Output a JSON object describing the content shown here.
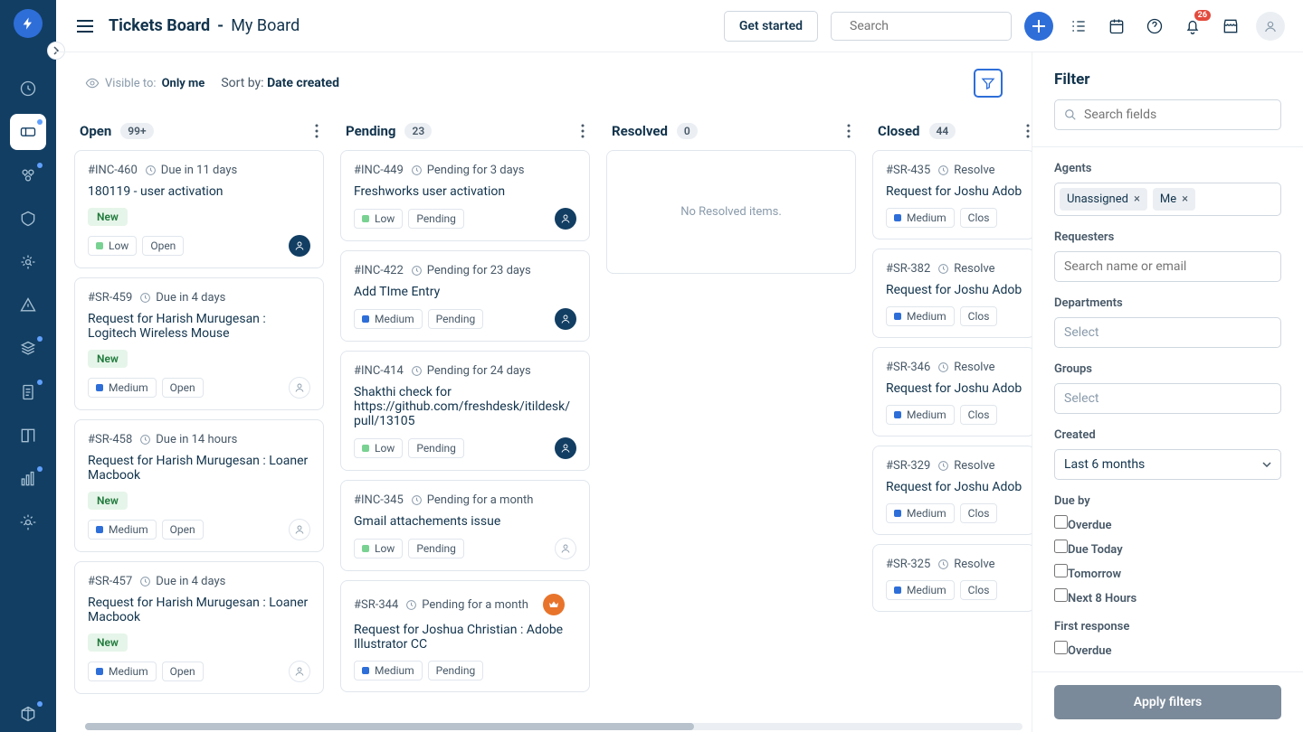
{
  "title": {
    "main": "Tickets Board",
    "sub": "My Board"
  },
  "topbar": {
    "get_started": "Get started",
    "search_placeholder": "Search",
    "notif_count": "26"
  },
  "subheader": {
    "visible_label": "Visible to:",
    "visible_value": "Only me",
    "sort_label": "Sort by:",
    "sort_value": "Date created"
  },
  "columns": [
    {
      "name": "Open",
      "count": "99+",
      "empty": null,
      "cards": [
        {
          "id": "#INC-460",
          "due": "Due in 11 days",
          "subject": "180119 - user activation",
          "new": true,
          "priority": "Low",
          "status": "Open",
          "avatar": "dark"
        },
        {
          "id": "#SR-459",
          "due": "Due in 4 days",
          "subject": "Request for Harish Murugesan : Logitech Wireless Mouse",
          "new": true,
          "priority": "Medium",
          "status": "Open",
          "avatar": "lite"
        },
        {
          "id": "#SR-458",
          "due": "Due in 14 hours",
          "subject": "Request for Harish Murugesan : Loaner Macbook",
          "new": true,
          "priority": "Medium",
          "status": "Open",
          "avatar": "lite"
        },
        {
          "id": "#SR-457",
          "due": "Due in 4 days",
          "subject": "Request for Harish Murugesan : Loaner Macbook",
          "new": true,
          "priority": "Medium",
          "status": "Open",
          "avatar": "lite"
        }
      ]
    },
    {
      "name": "Pending",
      "count": "23",
      "empty": null,
      "cards": [
        {
          "id": "#INC-449",
          "due": "Pending for 3 days",
          "subject": "Freshworks user activation",
          "new": false,
          "priority": "Low",
          "status": "Pending",
          "avatar": "dark"
        },
        {
          "id": "#INC-422",
          "due": "Pending for 23 days",
          "subject": "Add TIme Entry",
          "new": false,
          "priority": "Medium",
          "status": "Pending",
          "avatar": "dark"
        },
        {
          "id": "#INC-414",
          "due": "Pending for 24 days",
          "subject": "Shakthi check for https://github.com/freshdesk/itildesk/pull/13105",
          "new": false,
          "priority": "Low",
          "status": "Pending",
          "avatar": "dark"
        },
        {
          "id": "#INC-345",
          "due": "Pending for a month",
          "subject": "Gmail attachements issue",
          "new": false,
          "priority": "Low",
          "status": "Pending",
          "avatar": "lite"
        },
        {
          "id": "#SR-344",
          "due": "Pending for a month",
          "subject": "Request for Joshua Christian : Adobe Illustrator CC",
          "new": false,
          "priority": "Medium",
          "status": "Pending",
          "avatar": "orange",
          "avatar_inline": true
        }
      ]
    },
    {
      "name": "Resolved",
      "count": "0",
      "empty": "No Resolved items.",
      "cards": []
    },
    {
      "name": "Closed",
      "count": "44",
      "empty": null,
      "closed": true,
      "cards": [
        {
          "id": "#SR-435",
          "due": "Resolve",
          "subject": "Request for Joshu Adobe Illustrator C",
          "priority": "Medium",
          "status": "Clos"
        },
        {
          "id": "#SR-382",
          "due": "Resolve",
          "subject": "Request for Joshu Adobe Illustrator C",
          "priority": "Medium",
          "status": "Clos"
        },
        {
          "id": "#SR-346",
          "due": "Resolve",
          "subject": "Request for Joshu Adobe Illustrator C",
          "priority": "Medium",
          "status": "Clos"
        },
        {
          "id": "#SR-329",
          "due": "Resolve",
          "subject": "Request for Joshu Adobe Illustrator C",
          "priority": "Medium",
          "status": "Clos"
        },
        {
          "id": "#SR-325",
          "due": "Resolve",
          "subject": "",
          "priority": "Medium",
          "status": "Clos"
        }
      ]
    }
  ],
  "filter": {
    "title": "Filter",
    "search_placeholder": "Search fields",
    "agents_label": "Agents",
    "agent_pills": [
      "Unassigned",
      "Me"
    ],
    "requesters_label": "Requesters",
    "requesters_placeholder": "Search name or email",
    "departments_label": "Departments",
    "departments_placeholder": "Select",
    "groups_label": "Groups",
    "groups_placeholder": "Select",
    "created_label": "Created",
    "created_value": "Last 6 months",
    "dueby_label": "Due by",
    "dueby_options": [
      "Overdue",
      "Due Today",
      "Tomorrow",
      "Next 8 Hours"
    ],
    "firstresp_label": "First response",
    "firstresp_options": [
      "Overdue"
    ],
    "apply": "Apply filters"
  }
}
